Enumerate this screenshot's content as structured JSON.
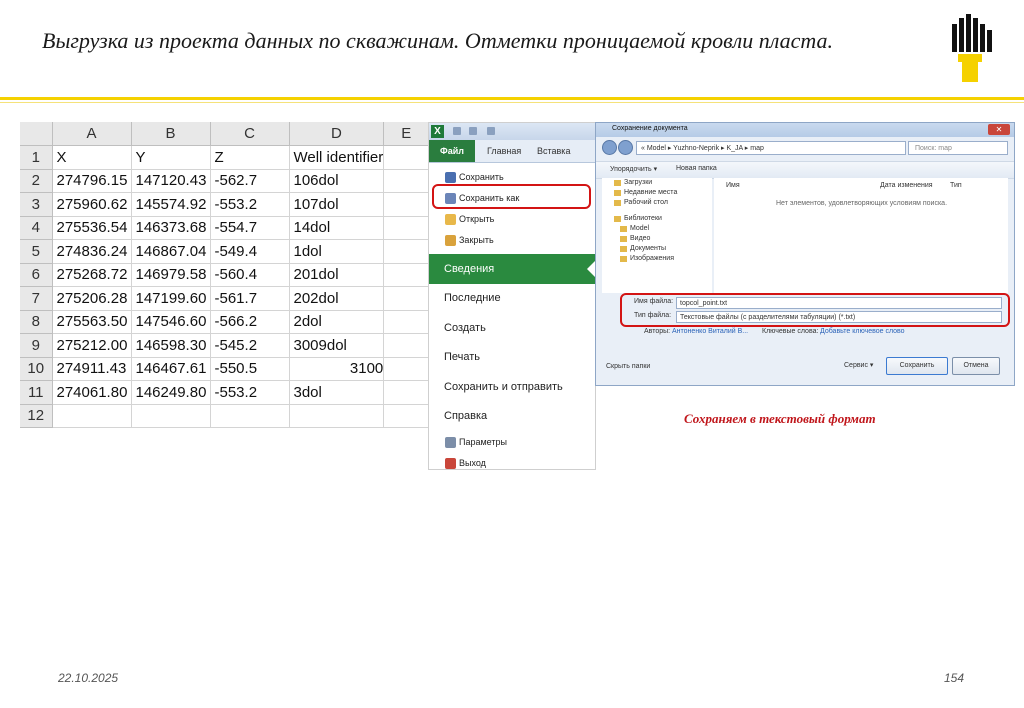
{
  "slide": {
    "title": "Выгрузка из проекта данных по скважинам. Отметки проницаемой кровли пласта.",
    "date": "22.10.2025",
    "page": "154",
    "caption": "Сохраняем в текстовый формат",
    "accent_color": "#f5d100"
  },
  "sheet": {
    "columns": [
      "A",
      "B",
      "C",
      "D",
      "E"
    ],
    "rows": [
      {
        "n": "1",
        "a": "X",
        "b": "Y",
        "c": "Z",
        "d": "Well identifier"
      },
      {
        "n": "2",
        "a": "274796.15",
        "b": "147120.43",
        "c": "-562.7",
        "d": "106dol"
      },
      {
        "n": "3",
        "a": "275960.62",
        "b": "145574.92",
        "c": "-553.2",
        "d": "107dol"
      },
      {
        "n": "4",
        "a": "275536.54",
        "b": "146373.68",
        "c": "-554.7",
        "d": "14dol"
      },
      {
        "n": "5",
        "a": "274836.24",
        "b": "146867.04",
        "c": "-549.4",
        "d": "1dol"
      },
      {
        "n": "6",
        "a": "275268.72",
        "b": "146979.58",
        "c": "-560.4",
        "d": "201dol"
      },
      {
        "n": "7",
        "a": "275206.28",
        "b": "147199.60",
        "c": "-561.7",
        "d": "202dol"
      },
      {
        "n": "8",
        "a": "275563.50",
        "b": "147546.60",
        "c": "-566.2",
        "d": "2dol"
      },
      {
        "n": "9",
        "a": "275212.00",
        "b": "146598.30",
        "c": "-545.2",
        "d": "3009dol"
      },
      {
        "n": "10",
        "a": "274911.43",
        "b": "146467.61",
        "c": "-550.5",
        "d": "3100"
      },
      {
        "n": "11",
        "a": "274061.80",
        "b": "146249.80",
        "c": "-553.2",
        "d": "3dol"
      },
      {
        "n": "12",
        "a": "",
        "b": "",
        "c": "",
        "d": ""
      }
    ]
  },
  "excel": {
    "tabs": {
      "file": "Файл",
      "home": "Главная",
      "insert": "Вставка"
    },
    "menu_small": [
      "Сохранить",
      "Сохранить как",
      "Открыть",
      "Закрыть"
    ],
    "menu_selected": "Сведения",
    "menu_big": [
      "Последние",
      "Создать",
      "Печать",
      "Сохранить и отправить",
      "Справка"
    ],
    "menu_bottom": [
      "Параметры",
      "Выход"
    ]
  },
  "dialog": {
    "title": "Сохранение документа",
    "path": "« Model ▸ Yuzhno-Neprik ▸ K_JA ▸ map",
    "search_placeholder": "Поиск: map",
    "organize": "Упорядочить ▾",
    "new_folder": "Новая папка",
    "nav_items": [
      "Загрузки",
      "Недавние места",
      "Рабочий стол",
      "Библиотеки",
      "Model",
      "Видео",
      "Документы",
      "Изображения"
    ],
    "col_name": "Имя",
    "col_date": "Дата изменения",
    "col_type": "Тип",
    "empty_text": "Нет элементов, удовлетворяющих условиям поиска.",
    "filename_label": "Имя файла:",
    "filename": "topcol_point.txt",
    "filetype_label": "Тип файла:",
    "filetype": "Текстовые файлы (с разделителями табуляции) (*.txt)",
    "authors_label": "Авторы:",
    "authors": "Антоненко Виталий В...",
    "keywords_label": "Ключевые слова:",
    "keywords": "Добавьте ключевое слово",
    "hide_folders": "Скрыть папки",
    "service": "Сервис ▾",
    "save": "Сохранить",
    "cancel": "Отмена"
  }
}
